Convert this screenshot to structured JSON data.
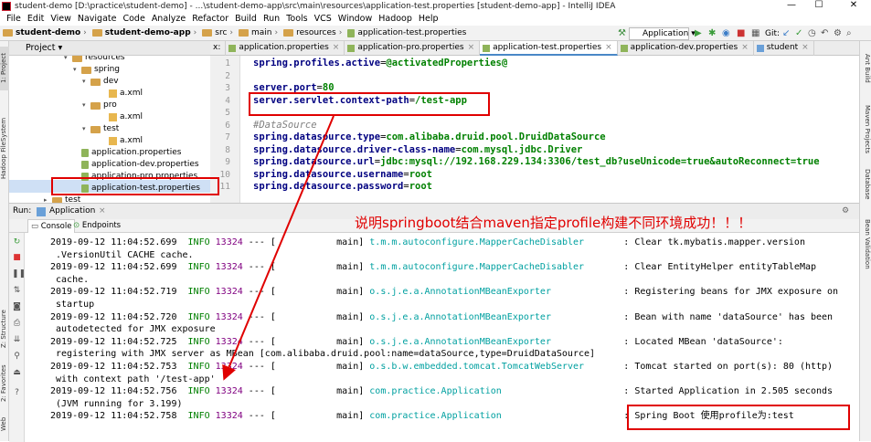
{
  "window": {
    "title": "student-demo [D:\\practice\\student-demo] - ...\\student-demo-app\\src\\main\\resources\\application-test.properties [student-demo-app] - IntelliJ IDEA",
    "minimize": "—",
    "maximize": "☐",
    "close": "✕"
  },
  "menu": [
    "File",
    "Edit",
    "View",
    "Navigate",
    "Code",
    "Analyze",
    "Refactor",
    "Build",
    "Run",
    "Tools",
    "VCS",
    "Window",
    "Hadoop",
    "Help"
  ],
  "breadcrumb": [
    "student-demo",
    "student-demo-app",
    "src",
    "main",
    "resources",
    "application-test.properties"
  ],
  "toolbar": {
    "run_config": "Application",
    "git_label": "Git:"
  },
  "left_tools": [
    "1: Project",
    "Hadoop FileSystem",
    "Z: Structure",
    "2: Favorites",
    "Web"
  ],
  "right_tools": [
    "Ant Build",
    "Maven Projects",
    "Database",
    "Bean Validation"
  ],
  "project": {
    "header": "Project",
    "tree": [
      {
        "label": "resources",
        "kind": "folder"
      },
      {
        "label": "spring",
        "kind": "folder"
      },
      {
        "label": "dev",
        "kind": "folder"
      },
      {
        "label": "a.xml",
        "kind": "xml"
      },
      {
        "label": "pro",
        "kind": "folder"
      },
      {
        "label": "a.xml",
        "kind": "xml"
      },
      {
        "label": "test",
        "kind": "folder"
      },
      {
        "label": "a.xml",
        "kind": "xml"
      },
      {
        "label": "application.properties",
        "kind": "prop"
      },
      {
        "label": "application-dev.properties",
        "kind": "prop"
      },
      {
        "label": "application-pro.properties",
        "kind": "prop"
      },
      {
        "label": "application-test.properties",
        "kind": "prop"
      },
      {
        "label": "test",
        "kind": "folder"
      }
    ]
  },
  "tabs": [
    {
      "label": "x:",
      "active": false
    },
    {
      "label": "application.properties",
      "active": false
    },
    {
      "label": "application-pro.properties",
      "active": false
    },
    {
      "label": "application-test.properties",
      "active": true
    },
    {
      "label": "application-dev.properties",
      "active": false
    },
    {
      "label": "student",
      "active": false
    }
  ],
  "editor": {
    "lines": [
      {
        "n": "1",
        "key": "spring.profiles.active",
        "val": "@activatedProperties@"
      },
      {
        "n": "2",
        "key": "",
        "val": ""
      },
      {
        "n": "3",
        "key": "server.port",
        "val": "80"
      },
      {
        "n": "4",
        "key": "server.servlet.context-path",
        "val": "/test-app"
      },
      {
        "n": "5",
        "key": "",
        "val": ""
      },
      {
        "n": "6",
        "comment": "#DataSource"
      },
      {
        "n": "7",
        "key": "spring.datasource.type",
        "val": "com.alibaba.druid.pool.DruidDataSource"
      },
      {
        "n": "8",
        "key": "spring.datasource.driver-class-name",
        "val": "com.mysql.jdbc.Driver"
      },
      {
        "n": "9",
        "key": "spring.datasource.url",
        "val": "jdbc:mysql://192.168.229.134:3306/test_db?useUnicode=true&autoReconnect=true"
      },
      {
        "n": "10",
        "key": "spring.datasource.username",
        "val": "root"
      },
      {
        "n": "11",
        "key": "spring.datasource.password",
        "val": "root"
      }
    ]
  },
  "run": {
    "label": "Run:",
    "config": "Application",
    "tab_console": "Console",
    "tab_endpoints": "Endpoints",
    "log": [
      {
        "ts": "2019-09-12 11:04:52.699",
        "level": "INFO",
        "pid": "13324",
        "dash": "---",
        "thread": "[           main]",
        "logger": "t.m.m.autoconfigure.MapperCacheDisabler",
        "msg": ": Clear tk.mybatis.mapper.version",
        "cont": " .VersionUtil CACHE cache."
      },
      {
        "ts": "2019-09-12 11:04:52.699",
        "level": "INFO",
        "pid": "13324",
        "dash": "---",
        "thread": "[           main]",
        "logger": "t.m.m.autoconfigure.MapperCacheDisabler",
        "msg": ": Clear EntityHelper entityTableMap",
        "cont": " cache."
      },
      {
        "ts": "2019-09-12 11:04:52.719",
        "level": "INFO",
        "pid": "13324",
        "dash": "---",
        "thread": "[           main]",
        "logger": "o.s.j.e.a.AnnotationMBeanExporter",
        "msg": ": Registering beans for JMX exposure on",
        "cont": " startup"
      },
      {
        "ts": "2019-09-12 11:04:52.720",
        "level": "INFO",
        "pid": "13324",
        "dash": "---",
        "thread": "[           main]",
        "logger": "o.s.j.e.a.AnnotationMBeanExporter",
        "msg": ": Bean with name 'dataSource' has been",
        "cont": " autodetected for JMX exposure"
      },
      {
        "ts": "2019-09-12 11:04:52.725",
        "level": "INFO",
        "pid": "13324",
        "dash": "---",
        "thread": "[           main]",
        "logger": "o.s.j.e.a.AnnotationMBeanExporter",
        "msg": ": Located MBean 'dataSource':",
        "cont": " registering with JMX server as MBean [com.alibaba.druid.pool:name=dataSource,type=DruidDataSource]"
      },
      {
        "ts": "2019-09-12 11:04:52.753",
        "level": "INFO",
        "pid": "13324",
        "dash": "---",
        "thread": "[           main]",
        "logger": "o.s.b.w.embedded.tomcat.TomcatWebServer",
        "msg": ": Tomcat started on port(s): 80 (http)",
        "cont": " with context path '/test-app'"
      },
      {
        "ts": "2019-09-12 11:04:52.756",
        "level": "INFO",
        "pid": "13324",
        "dash": "---",
        "thread": "[           main]",
        "logger": "com.practice.Application",
        "msg": ": Started Application in 2.505 seconds",
        "cont": " (JVM running for 3.199)"
      },
      {
        "ts": "2019-09-12 11:04:52.758",
        "level": "INFO",
        "pid": "13324",
        "dash": "---",
        "thread": "[           main]",
        "logger": "com.practice.Application",
        "msg": ": Spring Boot 使用profile为:test",
        "cont": ""
      }
    ]
  },
  "annotation": "说明springboot结合maven指定profile构建不同环境成功！！！",
  "colors": {
    "annotation": "#e00000",
    "info": "#008000",
    "pid": "#800080",
    "logger": "#00a0a0",
    "key": "#000080",
    "value": "#008000"
  }
}
